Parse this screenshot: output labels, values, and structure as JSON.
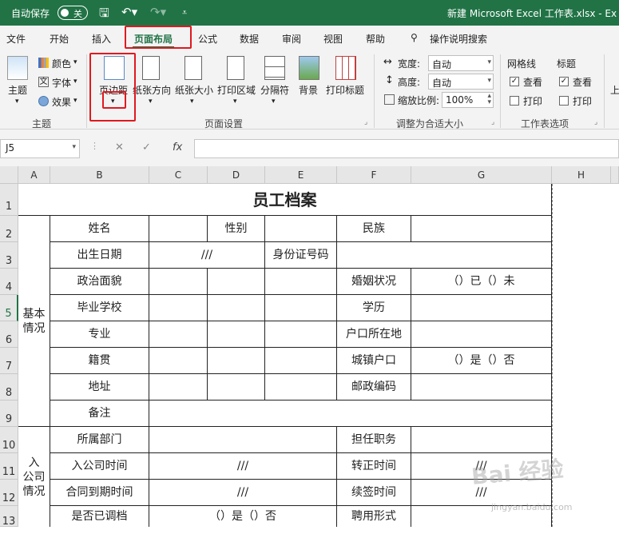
{
  "title_bar": {
    "autosave_label": "自动保存",
    "autosave_state": "关",
    "doc_title": "新建 Microsoft Excel 工作表.xlsx  -  Ex",
    "save_icon": "save-icon",
    "undo_icon": "undo-icon",
    "redo_icon": "redo-icon",
    "customize_icon": "customize-icon"
  },
  "tabs": [
    "文件",
    "开始",
    "插入",
    "页面布局",
    "公式",
    "数据",
    "审阅",
    "视图",
    "帮助"
  ],
  "search_label": "操作说明搜索",
  "ribbon": {
    "themes": {
      "theme": "主题",
      "colors": "颜色",
      "fonts": "字体",
      "effects": "效果",
      "group": "主题"
    },
    "page_setup": {
      "margins": "页边距",
      "orientation": "纸张方向",
      "size": "纸张大小",
      "print_area": "打印区域",
      "breaks": "分隔符",
      "background": "背景",
      "print_titles": "打印标题",
      "group": "页面设置"
    },
    "scale_to_fit": {
      "width_label": "宽度:",
      "width_value": "自动",
      "height_label": "高度:",
      "height_value": "自动",
      "scale_label": "缩放比例:",
      "scale_value": "100%",
      "group": "调整为合适大小"
    },
    "sheet_options": {
      "gridlines": "网格线",
      "headings": "标题",
      "view": "查看",
      "print": "打印",
      "group": "工作表选项"
    },
    "overflow": "上"
  },
  "formula_bar": {
    "name_box": "J5",
    "cancel": "✕",
    "enter": "✓",
    "fx": "fx",
    "value": ""
  },
  "columns": [
    "A",
    "B",
    "C",
    "D",
    "E",
    "F",
    "G",
    "H"
  ],
  "rows": [
    "1",
    "2",
    "3",
    "4",
    "5",
    "6",
    "7",
    "8",
    "9",
    "10",
    "11",
    "12",
    "13"
  ],
  "table": {
    "title": "员工档案",
    "basic_section": "基本\n情况",
    "join_section": "入\n公司\n情况",
    "name": "姓名",
    "gender": "性别",
    "ethnicity": "民族",
    "birth": "出生日期",
    "birth_value": "///",
    "id_number": "身份证号码",
    "political": "政治面貌",
    "marital": "婚姻状况",
    "marital_value": "（）已（）未",
    "school": "毕业学校",
    "education": "学历",
    "major": "专业",
    "hukou_place": "户口所在地",
    "native": "籍贯",
    "urban_hukou": "城镇户口",
    "urban_value": "（）是（）否",
    "address": "地址",
    "postcode": "邮政编码",
    "remarks": "备注",
    "dept": "所属部门",
    "position": "担任职务",
    "join_date": "入公司时间",
    "join_value": "///",
    "regular_date": "转正时间",
    "regular_value": "///",
    "contract_end": "合同到期时间",
    "contract_value": "///",
    "renew_date": "续签时间",
    "renew_value": "///",
    "filed": "是否已调档",
    "filed_value": "（）是（）否",
    "employ_type": "聘用形式"
  },
  "watermark": "Bai 经验",
  "watermark_url": "jingyan.baidu.com"
}
